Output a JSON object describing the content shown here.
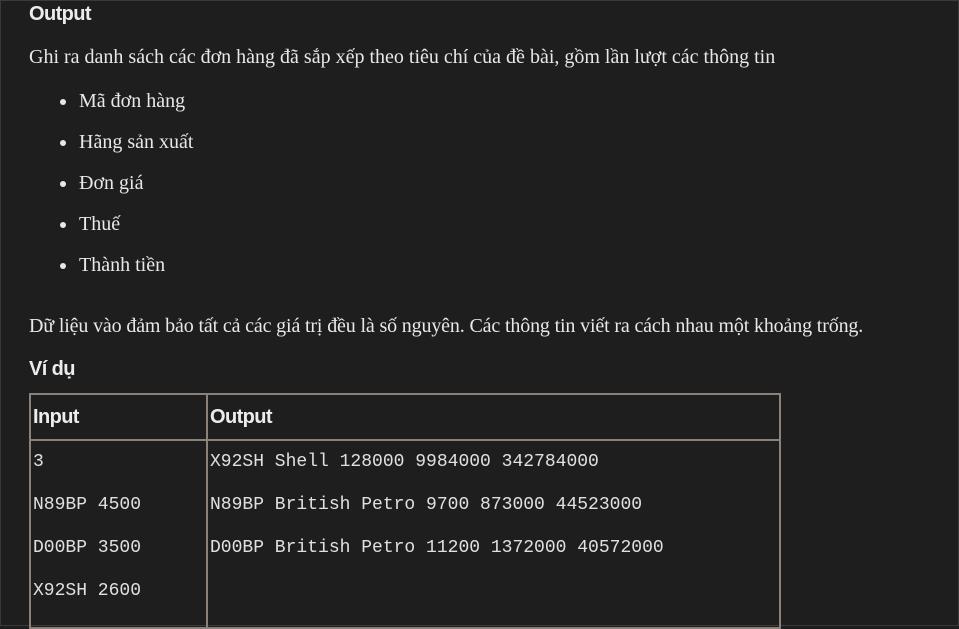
{
  "output_heading": "Output",
  "intro": "Ghi ra danh sách các đơn hàng đã sắp xếp theo tiêu chí của đề bài, gồm lần lượt các thông tin",
  "fields": [
    "Mã đơn hàng",
    "Hãng sản xuất",
    "Đơn giá",
    "Thuế",
    "Thành tiền"
  ],
  "note": "Dữ liệu vào đảm bảo tất cả các giá trị đều là số nguyên. Các thông tin viết ra cách nhau một khoảng trống.",
  "example_heading": "Ví dụ",
  "table": {
    "headers": [
      "Input",
      "Output"
    ],
    "input_lines": [
      "3",
      "N89BP 4500",
      "D00BP 3500",
      "X92SH 2600"
    ],
    "output_lines": [
      "X92SH Shell 128000 9984000 342784000",
      "N89BP British Petro 9700 873000 44523000",
      "D00BP British Petro 11200 1372000 40572000"
    ]
  }
}
